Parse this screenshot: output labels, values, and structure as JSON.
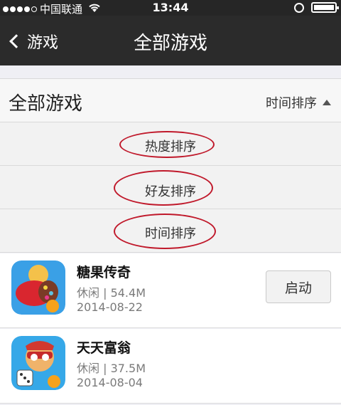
{
  "status_bar": {
    "carrier": "中国联通",
    "time": "13:44"
  },
  "nav": {
    "back_label": "游戏",
    "title": "全部游戏"
  },
  "section": {
    "title": "全部游戏",
    "sort_label": "时间排序"
  },
  "sort_options": [
    {
      "label": "热度排序"
    },
    {
      "label": "好友排序"
    },
    {
      "label": "时间排序"
    }
  ],
  "games": [
    {
      "name": "糖果传奇",
      "meta": "休闲 | 54.4M",
      "date": "2014-08-22",
      "button": "启动",
      "icon": "candy-crush-icon"
    },
    {
      "name": "天天富翁",
      "meta": "休闲 | 37.5M",
      "date": "2014-08-04",
      "icon": "tiantian-fuweng-icon"
    }
  ],
  "colors": {
    "highlight": "#c0192b",
    "nav_bg": "#2b2b2b"
  }
}
